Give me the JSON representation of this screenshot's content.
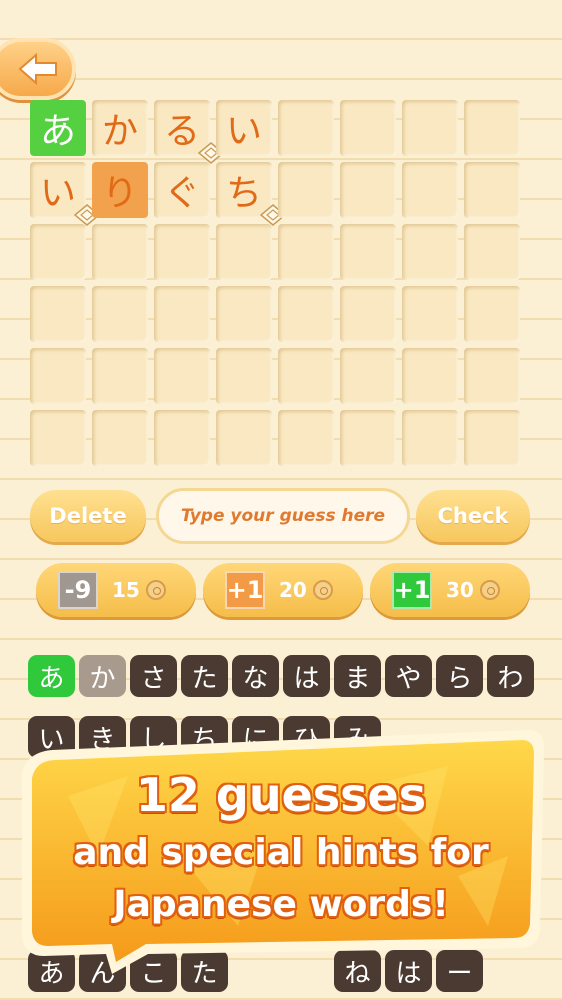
{
  "board": {
    "rows": [
      [
        "あ",
        "か",
        "る",
        "い",
        "",
        "",
        "",
        ""
      ],
      [
        "い",
        "り",
        "ぐ",
        "ち",
        "",
        "",
        "",
        ""
      ],
      [
        "",
        "",
        "",
        "",
        "",
        "",
        "",
        ""
      ],
      [
        "",
        "",
        "",
        "",
        "",
        "",
        "",
        ""
      ],
      [
        "",
        "",
        "",
        "",
        "",
        "",
        "",
        ""
      ],
      [
        "",
        "",
        "",
        "",
        "",
        "",
        "",
        ""
      ]
    ],
    "states": [
      [
        "hit",
        "empty",
        "empty",
        "empty",
        "empty",
        "empty",
        "empty",
        "empty"
      ],
      [
        "empty",
        "near",
        "empty",
        "empty",
        "empty",
        "empty",
        "empty",
        "empty"
      ],
      [
        "empty",
        "empty",
        "empty",
        "empty",
        "empty",
        "empty",
        "empty",
        "empty"
      ],
      [
        "empty",
        "empty",
        "empty",
        "empty",
        "empty",
        "empty",
        "empty",
        "empty"
      ],
      [
        "empty",
        "empty",
        "empty",
        "empty",
        "empty",
        "empty",
        "empty",
        "empty"
      ],
      [
        "empty",
        "empty",
        "empty",
        "empty",
        "empty",
        "empty",
        "empty",
        "empty"
      ]
    ],
    "badges": [
      [
        0,
        2
      ],
      [
        1,
        0
      ],
      [
        1,
        3
      ]
    ]
  },
  "actions": {
    "delete_label": "Delete",
    "input_placeholder": "Type your guess here",
    "check_label": "Check"
  },
  "hints": [
    {
      "tag": "-9",
      "cost": "15",
      "color": "#a09890"
    },
    {
      "tag": "+1",
      "cost": "20",
      "color": "#f29a45"
    },
    {
      "tag": "+1",
      "cost": "30",
      "color": "#2fc93b"
    }
  ],
  "keyboard": {
    "row1": [
      "あ",
      "か",
      "さ",
      "た",
      "な",
      "は",
      "ま",
      "や",
      "ら",
      "わ"
    ],
    "row1_states": [
      "green",
      "grey",
      "",
      "",
      "",
      "",
      "",
      "",
      "",
      ""
    ],
    "row2": [
      "い",
      "き",
      "し",
      "ち",
      "に",
      "ひ",
      "み"
    ],
    "row_bottom": [
      "あ",
      "ん",
      "こ",
      "た",
      "",
      "",
      "ね",
      "は",
      "ー"
    ]
  },
  "banner": {
    "line1": "12 guesses",
    "line2": "and special hints for",
    "line3": "Japanese words!"
  },
  "colors": {
    "accent": "#f6a94a",
    "hit": "#55d040",
    "near": "#f2a24c",
    "key": "#4a3a31"
  }
}
